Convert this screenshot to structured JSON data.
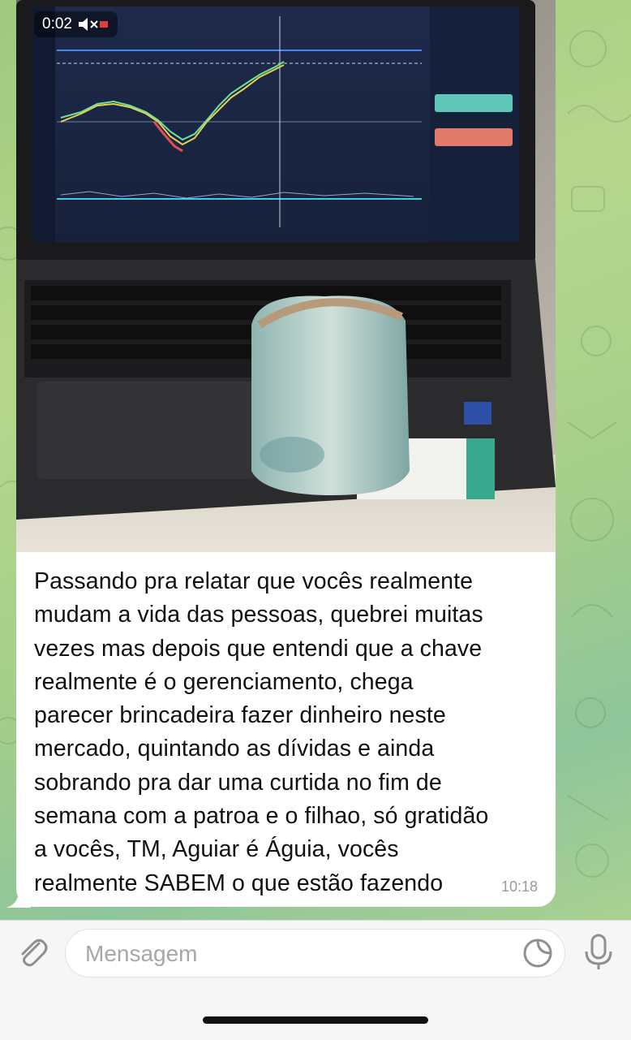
{
  "video": {
    "duration": "0:02",
    "muted_icon": "speaker-muted-icon",
    "description_icon": "video-thumbnail"
  },
  "message": {
    "lines": [
      "Passando pra relatar que vocês realmente",
      "mudam a vida das pessoas, quebrei muitas",
      "vezes mas depois que entendi que a chave",
      "realmente é o gerenciamento, chega",
      "parecer brincadeira fazer dinheiro neste",
      "mercado, quintando as dívidas e ainda",
      "sobrando pra dar uma curtida no fim de",
      "semana com a patroa e o filhao, só gratidão",
      "a vocês, TM, Aguiar é Águia, vocês",
      "realmente SABEM o que estão fazendo"
    ],
    "time": "10:18"
  },
  "input": {
    "placeholder": "Mensagem",
    "attach_icon": "paperclip-icon",
    "sticker_icon": "sticker-icon",
    "mic_icon": "microphone-icon"
  },
  "colors": {
    "chat_background": "#a5cf8a",
    "bubble": "#ffffff",
    "text": "#111111",
    "time": "#9a9a9a"
  }
}
